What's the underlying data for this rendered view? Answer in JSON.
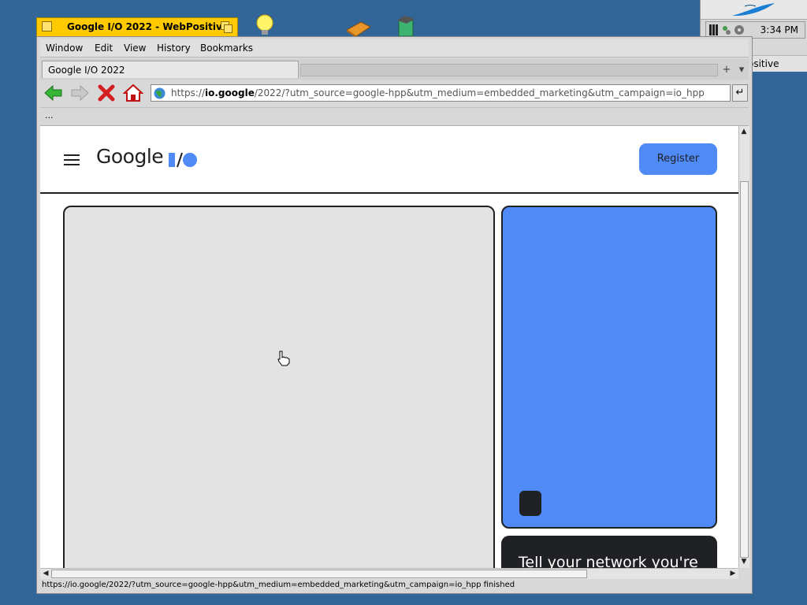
{
  "window": {
    "title": "Google I/O 2022 - WebPositive"
  },
  "menubar": {
    "items": [
      "Window",
      "Edit",
      "View",
      "History",
      "Bookmarks"
    ]
  },
  "tabs": [
    {
      "label": "Google I/O 2022"
    }
  ],
  "navigation": {
    "url_prefix": "https://",
    "url_host": "io.google",
    "url_rest": "/2022/?utm_source=google-hpp&utm_medium=embedded_marketing&utm_campaign=io_hpp"
  },
  "bookmarks": {
    "overflow_label": "..."
  },
  "page": {
    "logo_text": "Google",
    "register_label": "Register",
    "promo_text": "Tell your network you're"
  },
  "status": {
    "text": "https://io.google/2022/?utm_source=google-hpp&utm_medium=embedded_marketing&utm_campaign=io_hpp finished"
  },
  "deskbar": {
    "clock": "3:34 PM",
    "app_entry": "ositive"
  },
  "colors": {
    "desktop": "#336698",
    "window_tab": "#ffcb00",
    "io_blue": "#4f8af6",
    "dark": "#202124"
  }
}
